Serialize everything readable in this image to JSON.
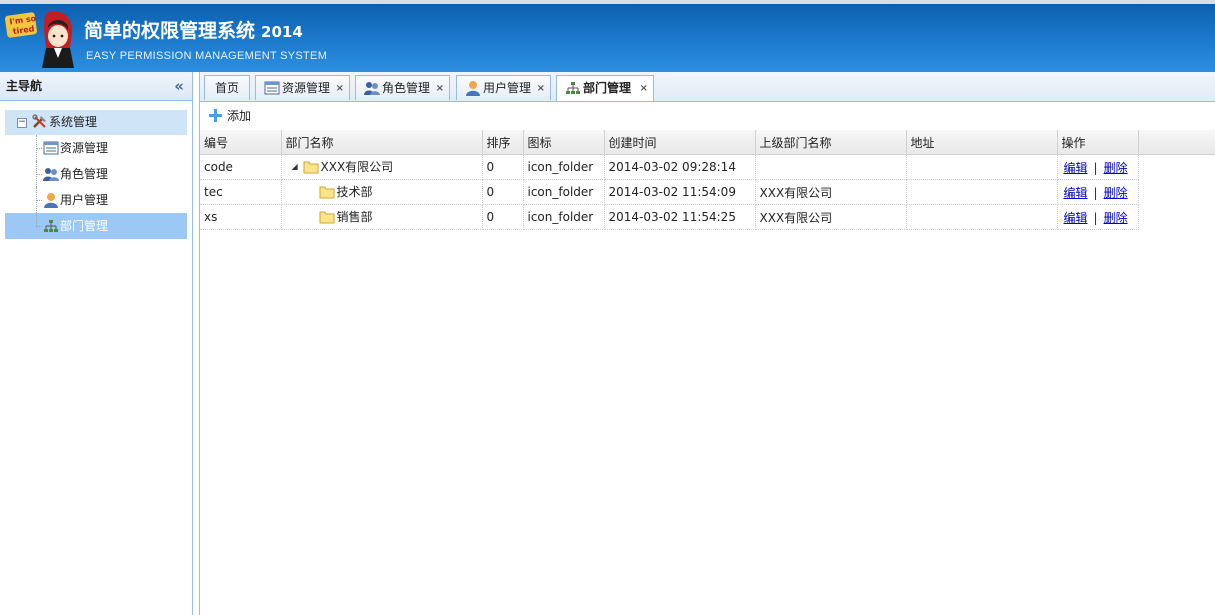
{
  "header": {
    "title": "简单的权限管理系统",
    "year": "2014",
    "subtitle": "EASY PERMISSION MANAGEMENT SYSTEM",
    "logo_text_line1": "I'm so",
    "logo_text_line2": "tired"
  },
  "nav": {
    "title": "主导航",
    "collapse_icon": "«",
    "root": {
      "label": "系统管理",
      "icon": "tools-icon",
      "toggle": "−"
    },
    "items": [
      {
        "label": "资源管理",
        "icon": "resource-icon"
      },
      {
        "label": "角色管理",
        "icon": "role-icon"
      },
      {
        "label": "用户管理",
        "icon": "user-icon"
      },
      {
        "label": "部门管理",
        "icon": "department-icon",
        "selected": true
      }
    ]
  },
  "tabs": [
    {
      "label": "首页",
      "closable": false
    },
    {
      "label": "资源管理",
      "closable": true
    },
    {
      "label": "角色管理",
      "closable": true
    },
    {
      "label": "用户管理",
      "closable": true
    },
    {
      "label": "部门管理",
      "closable": true,
      "active": true
    }
  ],
  "tab_close_glyph": "×",
  "toolbar": {
    "add_label": "添加"
  },
  "grid": {
    "columns": [
      "编号",
      "部门名称",
      "排序",
      "图标",
      "创建时间",
      "上级部门名称",
      "地址",
      "操作"
    ],
    "rows": [
      {
        "code": "code",
        "name": "XXX有限公司",
        "sort": "0",
        "icon": "icon_folder",
        "created": "2014-03-02 09:28:14",
        "parent": "",
        "address": "",
        "expanded": true,
        "level": 0
      },
      {
        "code": "tec",
        "name": "技术部",
        "sort": "0",
        "icon": "icon_folder",
        "created": "2014-03-02 11:54:09",
        "parent": "XXX有限公司",
        "address": "",
        "level": 1
      },
      {
        "code": "xs",
        "name": "销售部",
        "sort": "0",
        "icon": "icon_folder",
        "created": "2014-03-02 11:54:25",
        "parent": "XXX有限公司",
        "address": "",
        "level": 1
      }
    ],
    "edit_label": "编辑",
    "delete_label": "删除",
    "action_sep": "|",
    "expand_glyph": "◢"
  }
}
